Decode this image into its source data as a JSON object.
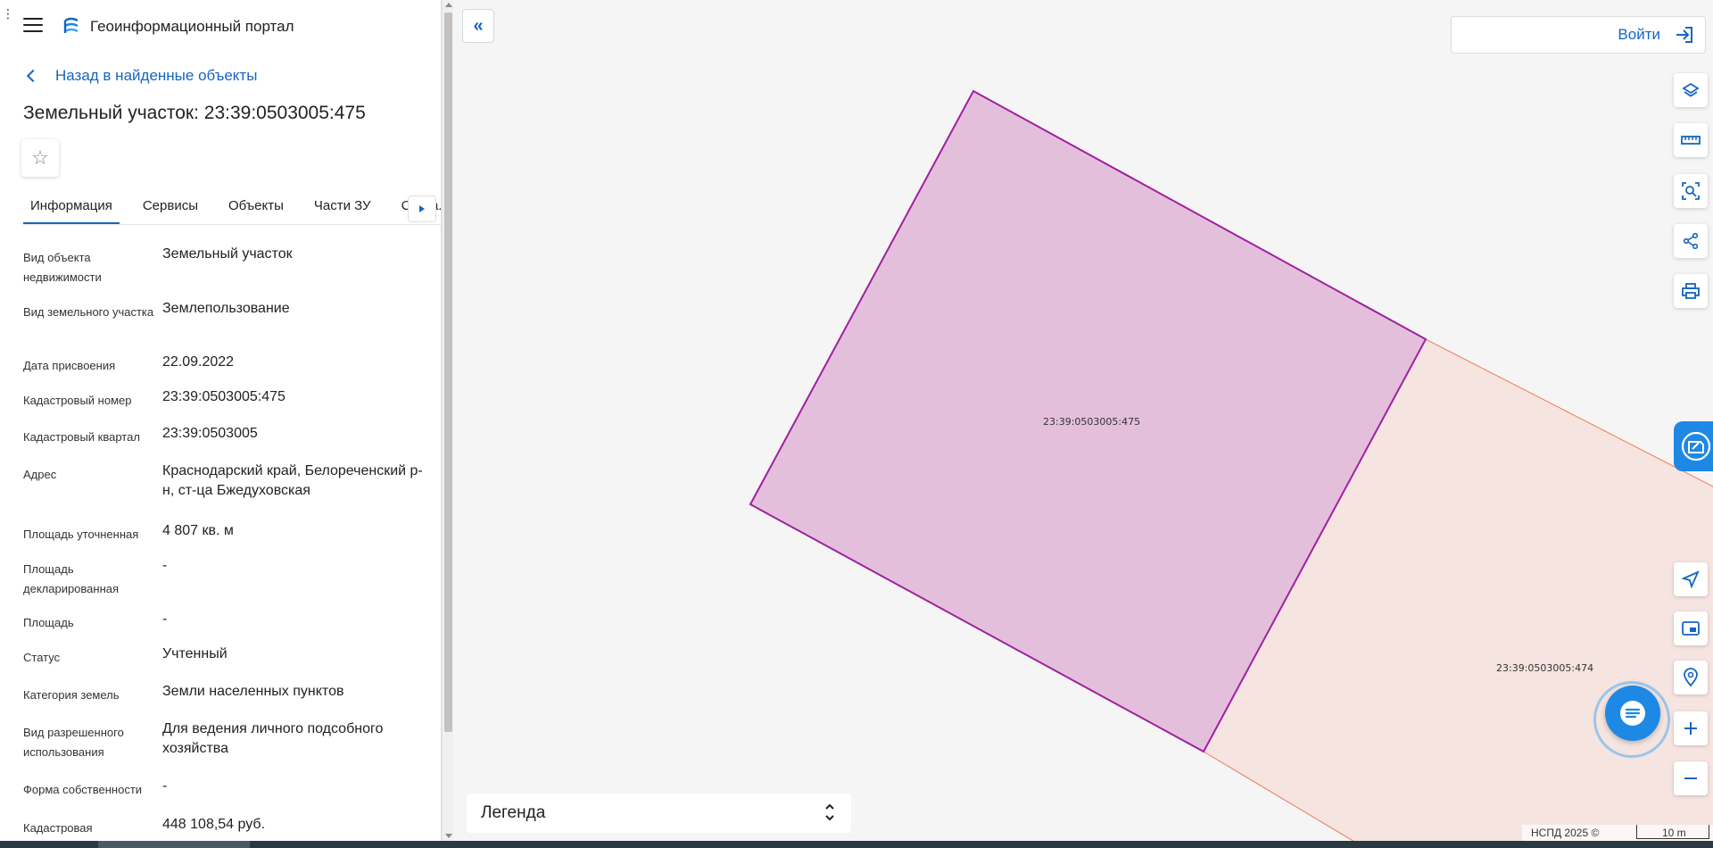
{
  "header": {
    "title": "Геоинформационный портал"
  },
  "panel": {
    "back_link": "Назад в найденные объекты",
    "object_title": "Земельный участок: 23:39:0503005:475",
    "tabs": [
      {
        "label": "Информация"
      },
      {
        "label": "Сервисы"
      },
      {
        "label": "Объекты"
      },
      {
        "label": "Части ЗУ"
      },
      {
        "label": "Соста..."
      }
    ],
    "properties": [
      {
        "label": "Вид объекта недвижимости",
        "value": "Земельный участок"
      },
      {
        "label": "Вид земельного участка",
        "value": "Землепользование"
      },
      {
        "label": "Дата присвоения",
        "value": "22.09.2022"
      },
      {
        "label": "Кадастровый номер",
        "value": "23:39:0503005:475"
      },
      {
        "label": "Кадастровый квартал",
        "value": "23:39:0503005"
      },
      {
        "label": "Адрес",
        "value": "Краснодарский край, Белореченский р-н, ст-ца Бжедуховская"
      },
      {
        "label": "Площадь уточненная",
        "value": "4 807 кв. м"
      },
      {
        "label": "Площадь декларированная",
        "value": "-"
      },
      {
        "label": "Площадь",
        "value": "-"
      },
      {
        "label": "Статус",
        "value": "Учтенный"
      },
      {
        "label": "Категория земель",
        "value": "Земли населенных пунктов"
      },
      {
        "label": "Вид разрешенного использования",
        "value": "Для ведения личного подсобного хозяйства"
      },
      {
        "label": "Форма собственности",
        "value": "-"
      },
      {
        "label": "Кадастровая",
        "value": "448 108,54 руб."
      }
    ]
  },
  "map": {
    "parcel_main_label": "23:39:0503005:475",
    "parcel_neighbor_label": "23:39:0503005:474",
    "login_label": "Войти",
    "legend_label": "Легенда",
    "attribution": "НСПД 2025 ©",
    "scale_label": "10 m"
  },
  "colors": {
    "accent": "#1565c0",
    "parcel_fill": "#e4bfdb",
    "parcel_stroke": "#a020a0",
    "neighbor_fill": "#f5e4e0",
    "neighbor_stroke": "#f07a5a"
  }
}
